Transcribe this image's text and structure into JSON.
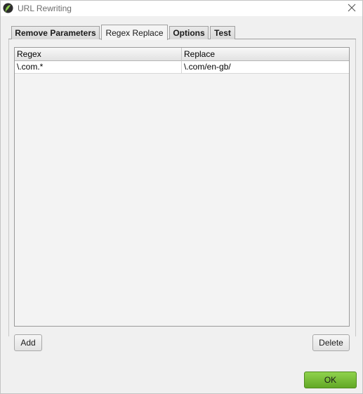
{
  "window": {
    "title": "URL Rewriting",
    "icon": "app-logo-icon",
    "close_icon": "close-icon"
  },
  "tabs": [
    {
      "label": "Remove Parameters",
      "active": false
    },
    {
      "label": "Regex Replace",
      "active": true
    },
    {
      "label": "Options",
      "active": false
    },
    {
      "label": "Test",
      "active": false
    }
  ],
  "table": {
    "columns": [
      "Regex",
      "Replace"
    ],
    "rows": [
      [
        "\\.com.*",
        "\\.com/en-gb/"
      ]
    ]
  },
  "buttons": {
    "add": "Add",
    "delete": "Delete",
    "ok": "OK"
  },
  "colors": {
    "ok_button": "#62a826",
    "window_bg": "#f0f0f0"
  }
}
